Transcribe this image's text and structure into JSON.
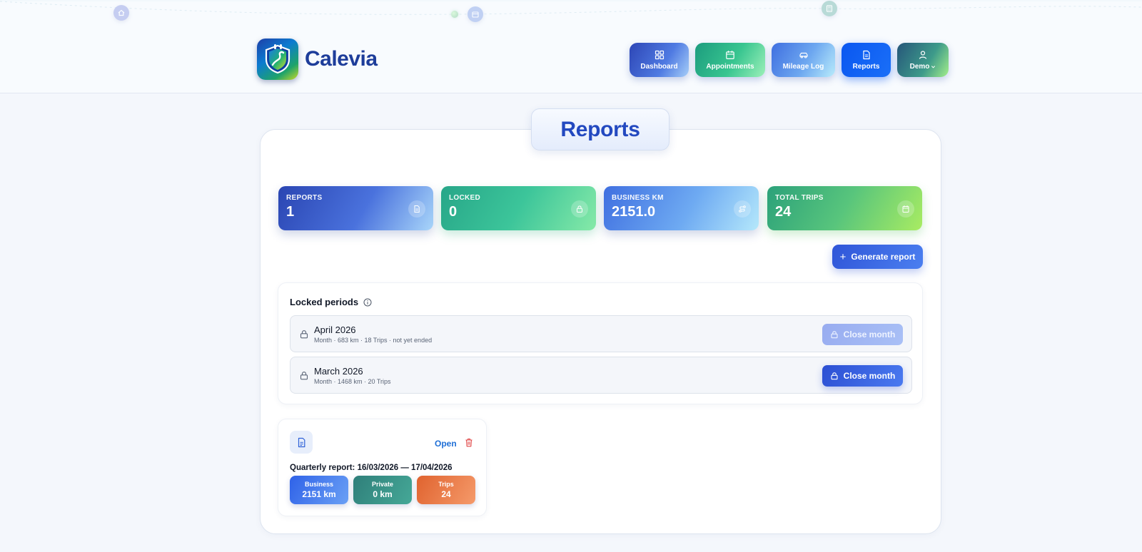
{
  "app": {
    "name": "Calevia"
  },
  "nav": {
    "dashboard": "Dashboard",
    "appointments": "Appointments",
    "mileage_log": "Mileage Log",
    "reports": "Reports",
    "user": "Demo"
  },
  "page": {
    "title": "Reports"
  },
  "stats": [
    {
      "label": "REPORTS",
      "value": "1",
      "icon": "document-icon"
    },
    {
      "label": "LOCKED",
      "value": "0",
      "icon": "lock-icon"
    },
    {
      "label": "BUSINESS KM",
      "value": "2151.0",
      "icon": "route-icon"
    },
    {
      "label": "TOTAL TRIPS",
      "value": "24",
      "icon": "calendar-icon"
    }
  ],
  "actions": {
    "generate_report": "Generate report"
  },
  "locked_periods": {
    "title": "Locked periods",
    "rows": [
      {
        "name": "April 2026",
        "meta": "Month · 683 km · 18 Trips · not yet ended",
        "button": "Close month",
        "enabled": false
      },
      {
        "name": "March 2026",
        "meta": "Month · 1468 km · 20 Trips",
        "button": "Close month",
        "enabled": true
      }
    ]
  },
  "report": {
    "open_label": "Open",
    "title": "Quarterly report: 16/03/2026 — 17/04/2026",
    "business": {
      "label": "Business",
      "value": "2151 km"
    },
    "private": {
      "label": "Private",
      "value": "0 km"
    },
    "trips": {
      "label": "Trips",
      "value": "24"
    }
  },
  "colors": {
    "brand": "#2349c0",
    "accent_blue": "#0a57f0",
    "green": "#3cc59a",
    "orange": "#e0632f",
    "danger": "#e04545"
  }
}
